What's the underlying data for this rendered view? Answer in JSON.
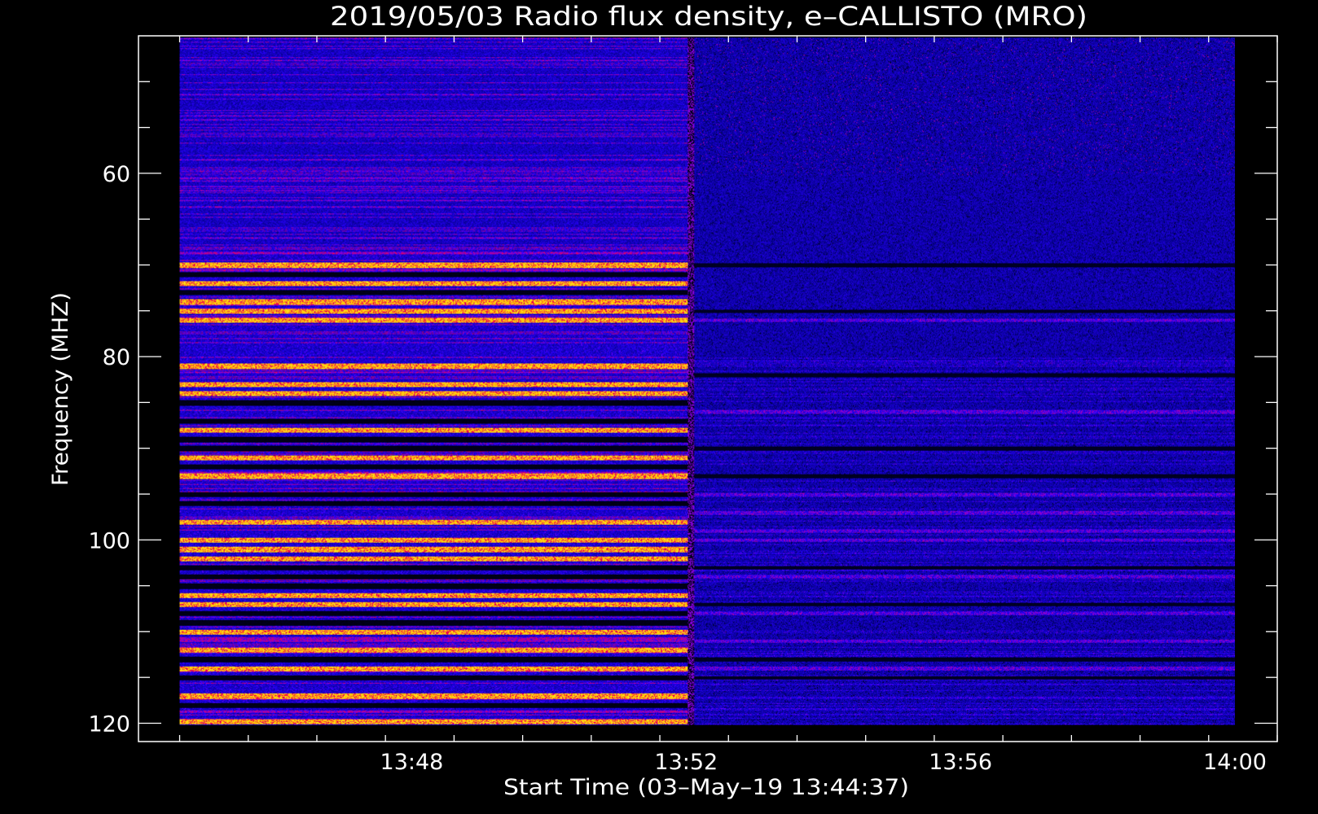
{
  "chart_data": {
    "type": "heatmap",
    "title": "2019/05/03  Radio flux density, e–CALLISTO (MRO)",
    "xlabel": "Start Time (03–May–19 13:44:37)",
    "ylabel": "Frequency (MHZ)",
    "x_tick_labels": [
      "13:48",
      "13:52",
      "13:56",
      "14:00"
    ],
    "x_ticks_minutes": [
      3.383,
      7.383,
      11.383,
      15.383
    ],
    "x_range_minutes": [
      -0.6,
      16.0
    ],
    "data_x_range_minutes": [
      0.0,
      15.383
    ],
    "y_tick_labels": [
      "60",
      "80",
      "100",
      "120"
    ],
    "y_ticks": [
      60,
      80,
      100,
      120
    ],
    "ylim": [
      45,
      122
    ],
    "data_y_range": [
      45.2,
      120.2
    ],
    "y_inverted": true,
    "colormap": [
      "#000000",
      "#0000ff",
      "#ff0000",
      "#ffff00"
    ],
    "transition_time": "13:52",
    "bright_bands_before_transition_mhz": [
      70,
      72,
      74,
      75,
      76,
      81,
      83,
      84,
      88,
      91,
      93,
      98,
      100,
      101,
      102,
      106,
      107,
      110,
      112,
      114,
      117,
      119.8
    ],
    "dark_bands_before_transition_mhz": [
      71,
      73,
      85,
      87,
      89,
      90,
      92,
      95,
      96,
      103,
      104,
      105,
      108,
      109,
      113,
      115,
      118
    ],
    "weak_bands_after_transition_mhz": [
      76,
      86,
      95,
      97,
      99,
      100,
      104,
      108,
      111,
      114
    ],
    "dark_bands_after_transition_mhz": [
      70,
      75,
      82,
      90,
      93,
      103,
      107,
      113,
      115
    ]
  }
}
